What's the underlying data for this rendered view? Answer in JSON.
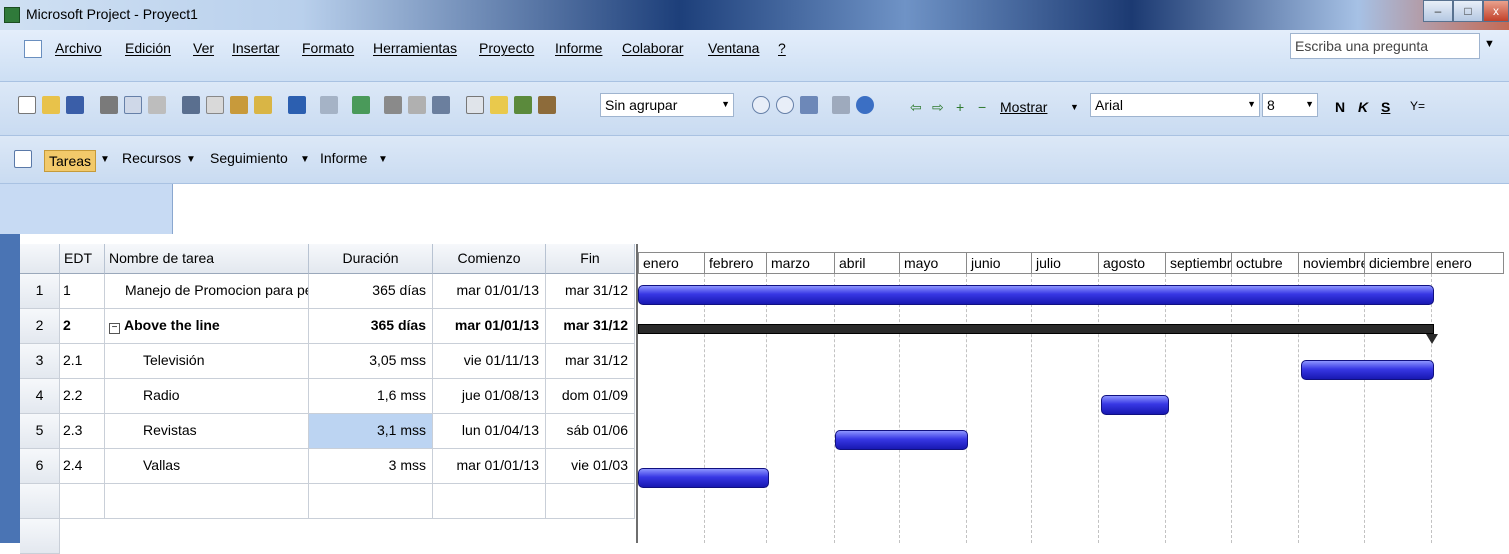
{
  "window": {
    "title": "Microsoft Project - Proyect1"
  },
  "menu": {
    "items": [
      "Archivo",
      "Edición",
      "Ver",
      "Insertar",
      "Formato",
      "Herramientas",
      "Proyecto",
      "Informe",
      "Colaborar",
      "Ventana",
      "?"
    ],
    "help_placeholder": "Escriba una pregunta"
  },
  "toolbar": {
    "group_value": "Sin agrupar",
    "show_label": "Mostrar",
    "font_value": "Arial",
    "size_value": "8",
    "bold": "N",
    "italic": "K",
    "underline": "S",
    "filter": "Y="
  },
  "guide": {
    "tabs": [
      "Tareas",
      "Recursos",
      "Seguimiento",
      "Informe"
    ]
  },
  "table": {
    "headers": {
      "edt": "EDT",
      "name": "Nombre de tarea",
      "duration": "Duración",
      "start": "Comienzo",
      "end": "Fin"
    },
    "rows": [
      {
        "num": "1",
        "edt": "1",
        "name": "Manejo de Promocion para petit",
        "duration": "365 días",
        "start": "mar 01/01/13",
        "end": "mar 31/12"
      },
      {
        "num": "2",
        "edt": "2",
        "name": "Above the line",
        "duration": "365 días",
        "start": "mar 01/01/13",
        "end": "mar 31/12"
      },
      {
        "num": "3",
        "edt": "2.1",
        "name": "Televisión",
        "duration": "3,05 mss",
        "start": "vie 01/11/13",
        "end": "mar 31/12"
      },
      {
        "num": "4",
        "edt": "2.2",
        "name": "Radio",
        "duration": "1,6 mss",
        "start": "jue 01/08/13",
        "end": "dom 01/09"
      },
      {
        "num": "5",
        "edt": "2.3",
        "name": "Revistas",
        "duration": "3,1 mss",
        "start": "lun 01/04/13",
        "end": "sáb 01/06"
      },
      {
        "num": "6",
        "edt": "2.4",
        "name": "Vallas",
        "duration": "3 mss",
        "start": "mar 01/01/13",
        "end": "vie 01/03"
      }
    ]
  },
  "gantt": {
    "months": [
      "enero",
      "febrero",
      "marzo",
      "abril",
      "mayo",
      "junio",
      "julio",
      "agosto",
      "septiembre",
      "octubre",
      "noviembre",
      "diciembre",
      "enero"
    ]
  }
}
